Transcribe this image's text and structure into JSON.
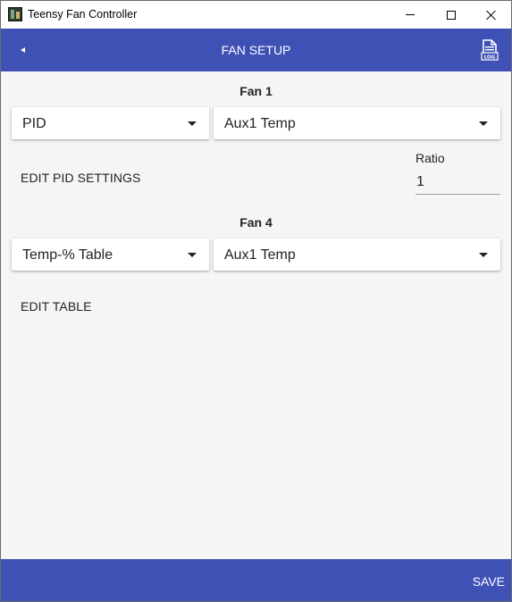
{
  "window": {
    "title": "Teensy Fan Controller"
  },
  "appbar": {
    "title": "FAN SETUP",
    "log_icon_label": "LOG"
  },
  "fans": [
    {
      "title": "Fan 1",
      "mode": "PID",
      "sensor": "Aux1 Temp",
      "edit_label": "EDIT PID SETTINGS",
      "ratio_label": "Ratio",
      "ratio_value": "1"
    },
    {
      "title": "Fan 4",
      "mode": "Temp-% Table",
      "sensor": "Aux1 Temp",
      "edit_label": "EDIT TABLE"
    }
  ],
  "bottombar": {
    "save_label": "SAVE"
  },
  "colors": {
    "primary": "#3f51b5",
    "background": "#f5f5f5",
    "card": "#ffffff"
  },
  "icons": [
    "app-icon",
    "minimize-icon",
    "maximize-icon",
    "close-icon",
    "back-arrow-icon",
    "log-file-icon",
    "dropdown-caret-icon"
  ]
}
